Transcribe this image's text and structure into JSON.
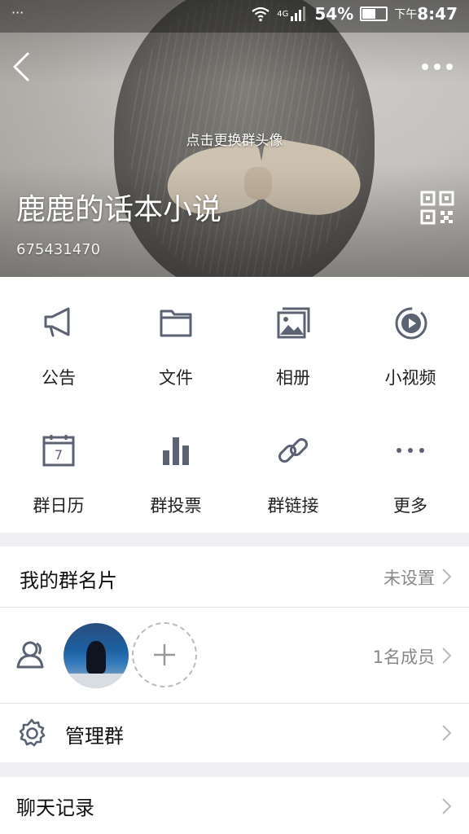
{
  "status_bar": {
    "dots": "···",
    "network": "4G",
    "battery": "54%",
    "time_prefix": "下午",
    "time": "8:47"
  },
  "header": {
    "change_avatar_hint": "点击更换群头像",
    "group_name": "鹿鹿的话本小说",
    "group_id": "675431470"
  },
  "features": [
    {
      "label": "公告",
      "icon": "megaphone-icon"
    },
    {
      "label": "文件",
      "icon": "folder-icon"
    },
    {
      "label": "相册",
      "icon": "album-icon"
    },
    {
      "label": "小视频",
      "icon": "video-icon"
    },
    {
      "label": "群日历",
      "icon": "calendar-icon"
    },
    {
      "label": "群投票",
      "icon": "bar-chart-icon"
    },
    {
      "label": "群链接",
      "icon": "link-icon"
    },
    {
      "label": "更多",
      "icon": "more-dots-icon"
    }
  ],
  "calendar_day": "7",
  "my_card": {
    "title": "我的群名片",
    "value": "未设置"
  },
  "members": {
    "count_text": "1名成员"
  },
  "manage": {
    "title": "管理群"
  },
  "chat_history": {
    "title": "聊天记录"
  },
  "colors": {
    "icon_gray": "#5b6272",
    "background": "#f0f0f2",
    "text": "#111111",
    "secondary": "#888888"
  }
}
